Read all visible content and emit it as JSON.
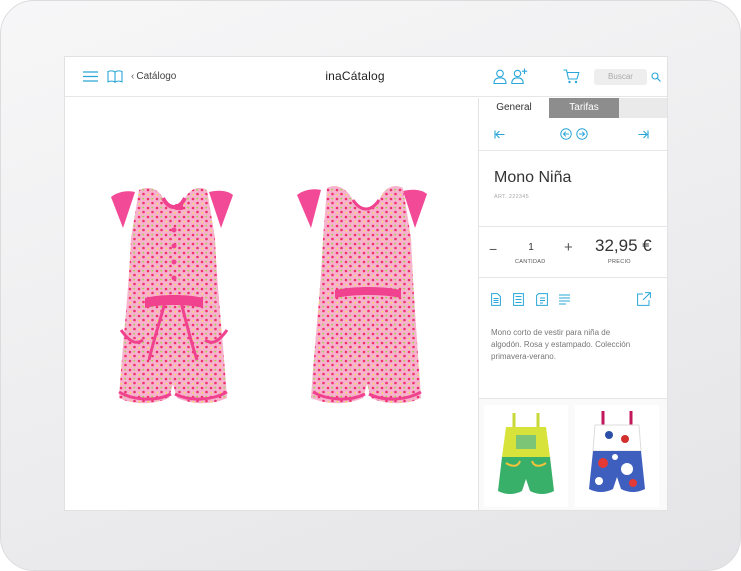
{
  "header": {
    "back_label": "Catálogo",
    "title": "inaCátalog",
    "search_placeholder": "Buscar"
  },
  "panel": {
    "tabs": [
      {
        "label": "General"
      },
      {
        "label": "Tarifas"
      }
    ],
    "product": {
      "name": "Mono Niña",
      "ref": "ART. 222345",
      "quantity": "1",
      "price": "32,95 €",
      "qty_label": "CANTIDAD",
      "price_label": "PRECIO",
      "description": "Mono corto de vestir para niña de algodón. Rosa y estampado. Colección primavera-verano."
    }
  },
  "icons": {
    "menu": "menu-icon",
    "book": "book-icon",
    "user": "user-icon",
    "add_user": "add-user-icon",
    "cart": "cart-icon",
    "search": "search-icon",
    "first": "first-icon",
    "prev": "prev-icon",
    "next": "next-icon",
    "last": "last-icon",
    "doc": "document-icon",
    "list": "list-icon",
    "tag": "tag-icon",
    "lines": "lines-icon",
    "share": "share-icon"
  },
  "colors": {
    "accent": "#2aa7d8",
    "garment_pink": "#f6a9c8",
    "garment_trim": "#f0428e",
    "tab_active_bg": "#8d8d8d"
  }
}
